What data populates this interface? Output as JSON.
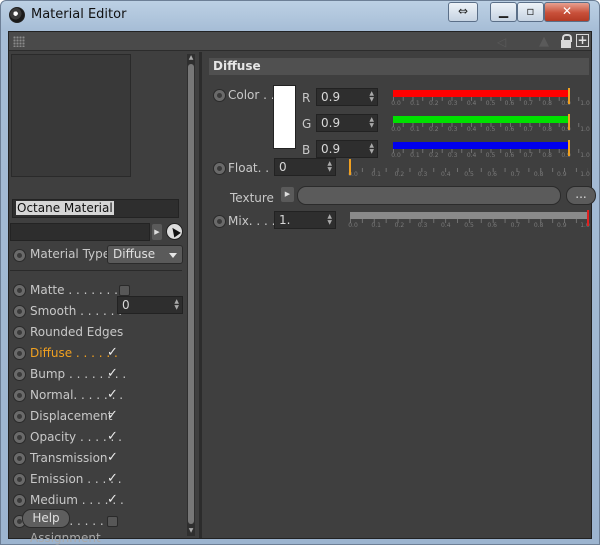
{
  "window": {
    "title": "Material Editor",
    "swap_glyph": "⇔",
    "min_glyph": "▁",
    "max_glyph": "▫",
    "close_glyph": "✕"
  },
  "toolbar": {
    "icons": [
      "grip-icon",
      "back-icon",
      "up-icon",
      "lock-icon",
      "plus-icon"
    ],
    "back_glyph": "◁",
    "up_glyph": "▲",
    "plus_glyph": "+"
  },
  "material": {
    "name": "Octane Material",
    "type_label": "Material Type",
    "type_value": "Diffuse"
  },
  "channels": [
    {
      "label": "Matte . . . . . . . .",
      "checked": false,
      "active": false
    },
    {
      "label": "Smooth . . . . . .",
      "checked": true,
      "active": false
    },
    {
      "label": "Rounded Edges",
      "value": "0",
      "active": false
    },
    {
      "label": "Diffuse . . . . . .",
      "checked": true,
      "active": true
    },
    {
      "label": "Bump . . . . . . . .",
      "checked": true,
      "active": false
    },
    {
      "label": "Normal. . . . . . .",
      "checked": true,
      "active": false
    },
    {
      "label": "Displacement",
      "checked": true,
      "active": false
    },
    {
      "label": "Opacity . . . . . .",
      "checked": true,
      "active": false
    },
    {
      "label": "Transmission",
      "checked": true,
      "active": false
    },
    {
      "label": "Emission . . . . .",
      "checked": true,
      "active": false
    },
    {
      "label": "Medium . . . . . .",
      "checked": true,
      "active": false
    },
    {
      "label": "Editor . . . . . . .",
      "checked": false,
      "active": false
    }
  ],
  "buttons": {
    "help": "Help",
    "assignment": "Assignment",
    "browse": "..."
  },
  "diffuse": {
    "header": "Diffuse",
    "color_label": "Color . .",
    "r_label": "R",
    "g_label": "G",
    "b_label": "B",
    "r_value": "0.9",
    "g_value": "0.9",
    "b_value": "0.9",
    "float_label": "Float. . .",
    "float_value": "0",
    "texture_label": "Texture",
    "mix_label": "Mix. . . .",
    "mix_value": "1.",
    "colors": {
      "r": "#ff0000",
      "g": "#00e000",
      "b": "#0000ee",
      "marker": "#f0a020",
      "mix_marker": "#e02020"
    }
  },
  "sliders": {
    "r": {
      "value": 0.9,
      "tick_labels": [
        "0.0",
        "0.1",
        "0.2",
        "0.3",
        "0.4",
        "0.5",
        "0.6",
        "0.7",
        "0.8",
        "0.9",
        "1.0"
      ]
    },
    "g": {
      "value": 0.9,
      "tick_labels": [
        "0.0",
        "0.1",
        "0.2",
        "0.3",
        "0.4",
        "0.5",
        "0.6",
        "0.7",
        "0.8",
        "0.9",
        "1.0"
      ]
    },
    "b": {
      "value": 0.9,
      "tick_labels": [
        "0.0",
        "0.1",
        "0.2",
        "0.3",
        "0.4",
        "0.5",
        "0.6",
        "0.7",
        "0.8",
        "0.9",
        "1.0"
      ]
    },
    "float": {
      "value": 0.0,
      "tick_labels": [
        "0.0",
        "0.1",
        "0.2",
        "0.3",
        "0.4",
        "0.5",
        "0.6",
        "0.7",
        "0.8",
        "0.9",
        "1.0"
      ]
    },
    "mix": {
      "value": 1.0,
      "tick_labels": [
        "0.0",
        "0.1",
        "0.2",
        "0.3",
        "0.4",
        "0.5",
        "0.6",
        "0.7",
        "0.8",
        "0.9",
        "1.0"
      ]
    }
  }
}
